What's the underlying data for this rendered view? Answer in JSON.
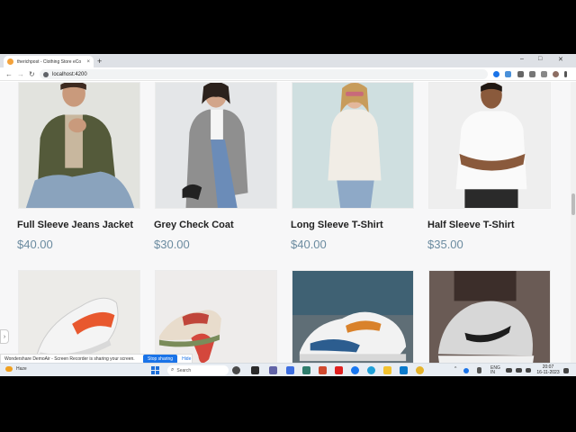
{
  "browser": {
    "tab_title": "therichpost - Clothing Store eCo",
    "tab_close": "×",
    "new_tab": "+",
    "window_controls": [
      "–",
      "□",
      "✕"
    ],
    "url": "localhost:4200",
    "nav": {
      "back": "←",
      "forward": "→",
      "reload": "↻"
    }
  },
  "products": [
    {
      "name": "Full Sleeve Jeans Jacket",
      "price": "$40.00"
    },
    {
      "name": "Grey Check Coat",
      "price": "$30.00"
    },
    {
      "name": "Long Sleeve T-Shirt",
      "price": "$40.00"
    },
    {
      "name": "Half Sleeve T-Shirt",
      "price": "$35.00"
    }
  ],
  "sidearrow": "›",
  "sharebar": {
    "message": "Wondershare DemoAir - Screen Recorder is sharing your screen.",
    "stop_label": "Stop sharing",
    "hide_label": "Hide"
  },
  "taskbar": {
    "weather": "Haze",
    "search_placeholder": "Search",
    "search_icon": "⌕",
    "lang_top": "ENG",
    "lang_bottom": "IN",
    "time": "20:07",
    "date": "16-11-2023",
    "chevron": "^"
  },
  "colors": {
    "price": "#6b8ba0",
    "accent": "#1a73e8"
  }
}
